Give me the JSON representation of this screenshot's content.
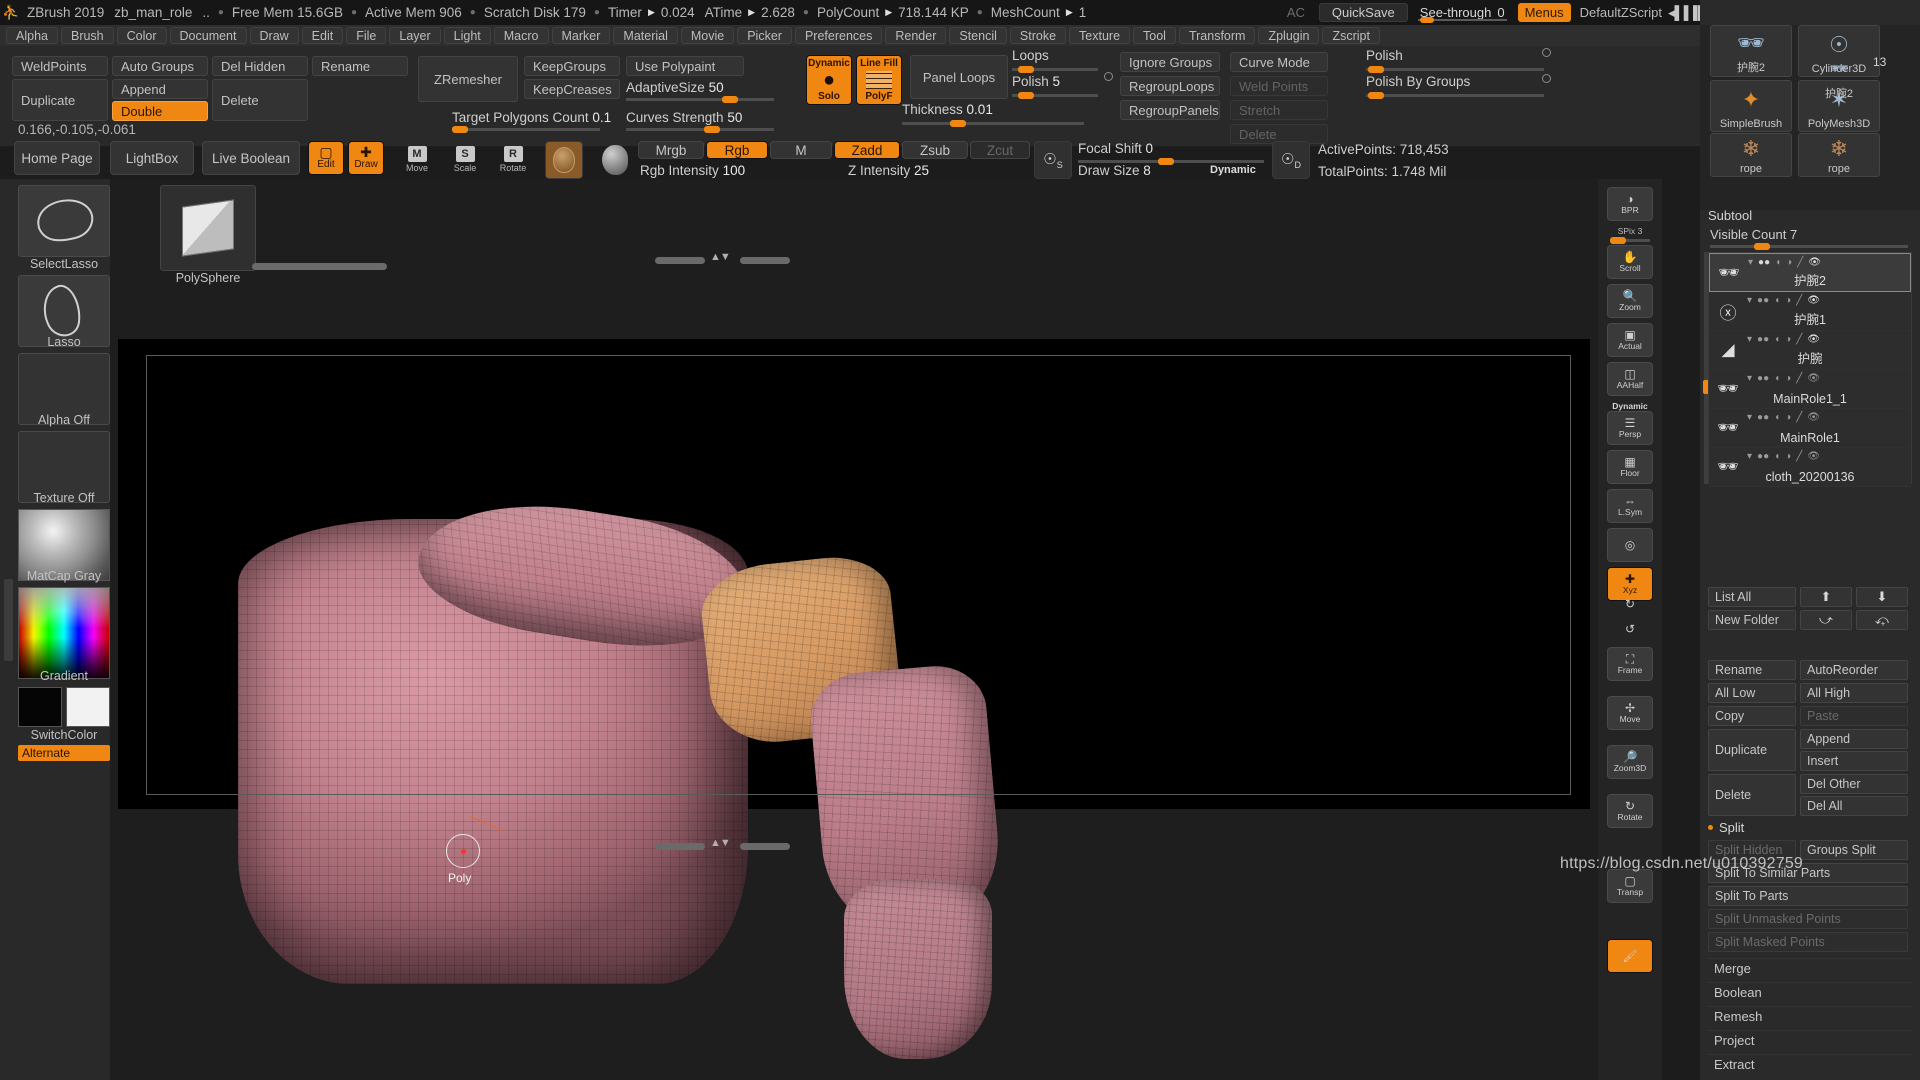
{
  "titlebar": {
    "app": "ZBrush 2019",
    "document": "zb_man_role",
    "ellipsis": "..",
    "stats": [
      {
        "label": "Free Mem 15.6GB"
      },
      {
        "label": "Active Mem 906"
      },
      {
        "label": "Scratch Disk 179"
      },
      {
        "label": "Timer",
        "arrow": true,
        "value": "0.024"
      },
      {
        "label": "ATime",
        "arrow": true,
        "value": "2.628"
      },
      {
        "label": "PolyCount",
        "arrow": true,
        "value": "718.144 KP"
      },
      {
        "label": "MeshCount",
        "arrow": true,
        "value": "1"
      }
    ],
    "ac": "AC",
    "quicksave": "QuickSave",
    "seethrough_label": "See-through",
    "seethrough_value": "0",
    "menus": "Menus",
    "zscript": "DefaultZScript",
    "icons": [
      "prev-tray-icon",
      "next-tray-icon",
      "prev-item-icon",
      "next-item-icon",
      "lock-icon"
    ],
    "window": {
      "minimize": "minimize-icon",
      "restore": "restore-icon",
      "close": "close-icon"
    }
  },
  "menubar": [
    "Alpha",
    "Brush",
    "Color",
    "Document",
    "Draw",
    "Edit",
    "File",
    "Layer",
    "Light",
    "Macro",
    "Marker",
    "Material",
    "Movie",
    "Picker",
    "Preferences",
    "Render",
    "Stencil",
    "Stroke",
    "Texture",
    "Tool",
    "Transform",
    "Zplugin",
    "Zscript"
  ],
  "shelf": {
    "geometry": {
      "weld_points": "WeldPoints",
      "auto_groups": "Auto Groups",
      "del_hidden": "Del Hidden",
      "rename": "Rename",
      "duplicate": "Duplicate",
      "append": "Append",
      "double": "Double",
      "delete": "Delete"
    },
    "zremesher": {
      "title": "ZRemesher",
      "keep_groups": "KeepGroups",
      "keep_creases": "KeepCreases",
      "use_polypaint": "Use Polypaint",
      "adaptive_size_label": "AdaptiveSize",
      "adaptive_size_value": "50",
      "target_polygons_label": "Target Polygons Count",
      "target_polygons_value": "0.1",
      "curves_strength_label": "Curves Strength",
      "curves_strength_value": "50"
    },
    "solo": {
      "top": "Dynamic",
      "cap": "Solo"
    },
    "polyf": {
      "top": "Line Fill",
      "cap": "PolyF"
    },
    "panel_loops": {
      "title": "Panel Loops",
      "thickness_label": "Thickness",
      "thickness_value": "0.01",
      "loops_label": "Loops",
      "polish_label": "Polish",
      "polish_value": "5",
      "ignore_groups": "Ignore Groups",
      "regroup_loops": "RegroupLoops",
      "regroup_panels": "RegroupPanels",
      "curve_mode": "Curve Mode",
      "weld_points": "Weld Points",
      "stretch": "Stretch",
      "delete": "Delete"
    },
    "polish": {
      "polish_label": "Polish",
      "polish_by_groups_label": "Polish By Groups"
    }
  },
  "coord_readout": "0.166,-0.105,-0.061",
  "maintoolbar": {
    "home_page": "Home Page",
    "lightbox": "LightBox",
    "live_boolean": "Live Boolean",
    "edit": "Edit",
    "draw": "Draw",
    "move": {
      "label": "Move",
      "key": "M"
    },
    "scale": {
      "label": "Scale",
      "key": "S"
    },
    "rotate": {
      "label": "Rotate",
      "key": "R"
    },
    "mrgb": "Mrgb",
    "rgb": "Rgb",
    "m": "M",
    "zadd": "Zadd",
    "zsub": "Zsub",
    "zcut": "Zcut",
    "rgb_intensity_label": "Rgb Intensity",
    "rgb_intensity_value": "100",
    "z_intensity_label": "Z Intensity",
    "z_intensity_value": "25",
    "focal_shift_label": "Focal Shift",
    "focal_shift_value": "0",
    "draw_size_label": "Draw Size",
    "draw_size_value": "8",
    "dynamic": "Dynamic",
    "active_points": "ActivePoints: 718,453",
    "total_points": "TotalPoints: 1.748 Mil"
  },
  "leftbar": {
    "select_lasso_name": "SelectLasso",
    "lasso_name": "Lasso",
    "alpha_off": "Alpha Off",
    "texture_off": "Texture Off",
    "matcap": "MatCap Gray",
    "gradient": "Gradient",
    "switch_color": "SwitchColor",
    "alternate": "Alternate"
  },
  "canvas": {
    "tool_thumb_name": "PolySphere",
    "brush_cursor_label": "Poly"
  },
  "navstrip": [
    {
      "name": "BPR",
      "icon": "bpr-icon",
      "active": false
    },
    {
      "name": "Scroll",
      "icon": "scroll-icon",
      "active": false
    },
    {
      "name": "Zoom",
      "icon": "zoom-icon",
      "active": false
    },
    {
      "name": "Actual",
      "icon": "actual-icon",
      "active": false
    },
    {
      "name": "AAHalf",
      "icon": "aahalf-icon",
      "active": false
    },
    {
      "name": "Persp",
      "icon": "persp-icon",
      "active": false
    },
    {
      "name": "Floor",
      "icon": "floor-icon",
      "active": false
    },
    {
      "name": "L.Sym",
      "icon": "lsym-icon",
      "active": false
    },
    {
      "name": "",
      "icon": "local-icon",
      "active": false
    },
    {
      "name": "Xyz",
      "icon": "xyz-icon",
      "active": true
    },
    {
      "name": "",
      "icon": "rotate-ccw-icon",
      "active": false
    },
    {
      "name": "",
      "icon": "rotate-cw-icon",
      "active": false
    },
    {
      "name": "Frame",
      "icon": "frame-icon",
      "active": false
    },
    {
      "name": "Move",
      "icon": "move-icon",
      "active": false
    },
    {
      "name": "Zoom3D",
      "icon": "zoom3d-icon",
      "active": false
    },
    {
      "name": "Rotate",
      "icon": "rotate-icon",
      "active": false
    },
    {
      "name": "Transp",
      "icon": "transp-icon",
      "active": false
    }
  ],
  "navstrip_spix": {
    "label": "SPix",
    "value": "3"
  },
  "navstrip_dynamic": "Dynamic",
  "tooltray": [
    {
      "name": "护腕2",
      "icon": "mannequin-icon"
    },
    {
      "name": "Cylinder3D",
      "icon": "cylinder-icon"
    },
    {
      "name": "SimpleBrush",
      "icon": "brush-icon"
    },
    {
      "name": "PolyMesh3D",
      "icon": "star-icon"
    },
    {
      "name": "护腕2",
      "icon": "mannequin-icon",
      "badge": "13"
    },
    {
      "name": "rope",
      "icon": "rope-icon"
    },
    {
      "name": "rope",
      "icon": "rope-icon"
    }
  ],
  "subtool": {
    "title": "Subtool",
    "visible_count_label": "Visible Count",
    "visible_count_value": "7",
    "items": [
      {
        "name": "护腕2",
        "selected": true,
        "thumb": "figure-icon",
        "eye": true
      },
      {
        "name": "护腕1",
        "selected": false,
        "thumb": "arm-icon",
        "eye": true
      },
      {
        "name": "护腕",
        "selected": false,
        "thumb": "cuff-icon",
        "eye": true
      },
      {
        "name": "MainRole1_1",
        "selected": false,
        "thumb": "figure-icon",
        "eye": false
      },
      {
        "name": "MainRole1",
        "selected": false,
        "thumb": "figure-icon",
        "eye": false
      },
      {
        "name": "cloth_20200136",
        "selected": false,
        "thumb": "figure-icon",
        "eye": false
      }
    ],
    "list_all": "List All",
    "new_folder": "New Folder",
    "arrow_up": "up-arrow-icon",
    "arrow_down": "down-arrow-icon",
    "arrow_out": "move-out-icon",
    "arrow_in": "move-in-icon",
    "rename": "Rename",
    "auto_reorder": "AutoReorder",
    "all_low": "All Low",
    "all_high": "All High",
    "copy": "Copy",
    "paste": "Paste",
    "duplicate": "Duplicate",
    "append": "Append",
    "insert": "Insert",
    "delete": "Delete",
    "del_other": "Del Other",
    "del_all": "Del All",
    "split_section": "Split",
    "split_hidden": "Split Hidden",
    "groups_split": "Groups Split",
    "split_to_similar_parts": "Split To Similar Parts",
    "split_to_parts": "Split To Parts",
    "split_unmasked_points": "Split Unmasked Points",
    "split_masked_points": "Split Masked Points",
    "merge": "Merge",
    "boolean": "Boolean",
    "remesh": "Remesh",
    "project": "Project",
    "extract": "Extract"
  },
  "watermark": "https://blog.csdn.net/u010392759",
  "colors": {
    "accent": "#f08712",
    "panel": "#2a2a2a",
    "shelf": "#292929",
    "titlebar": "#161616"
  }
}
